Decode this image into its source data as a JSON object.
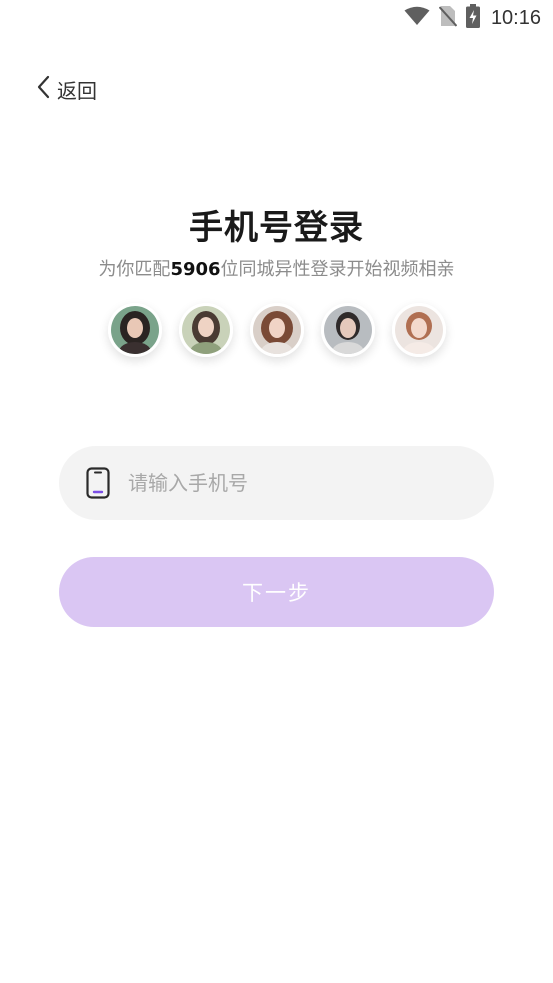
{
  "status_bar": {
    "time": "10:16",
    "icons": [
      "wifi-icon",
      "no-sim-icon",
      "battery-charging-icon"
    ]
  },
  "nav": {
    "back_label": "返回",
    "back_icon": "chevron-left-icon"
  },
  "header": {
    "title": "手机号登录",
    "subtitle_prefix": "为你匹配",
    "match_count": "5906",
    "subtitle_suffix": "位同城异性登录开始视频相亲"
  },
  "avatars": [
    {
      "name": "avatar-1"
    },
    {
      "name": "avatar-2"
    },
    {
      "name": "avatar-3"
    },
    {
      "name": "avatar-4"
    },
    {
      "name": "avatar-5"
    }
  ],
  "form": {
    "phone_placeholder": "请输入手机号",
    "phone_value": "",
    "phone_icon": "mobile-phone-icon",
    "next_label": "下一步"
  },
  "colors": {
    "accent": "#dac6f3",
    "accent_icon": "#7b4ee6",
    "input_bg": "#f3f3f3"
  }
}
